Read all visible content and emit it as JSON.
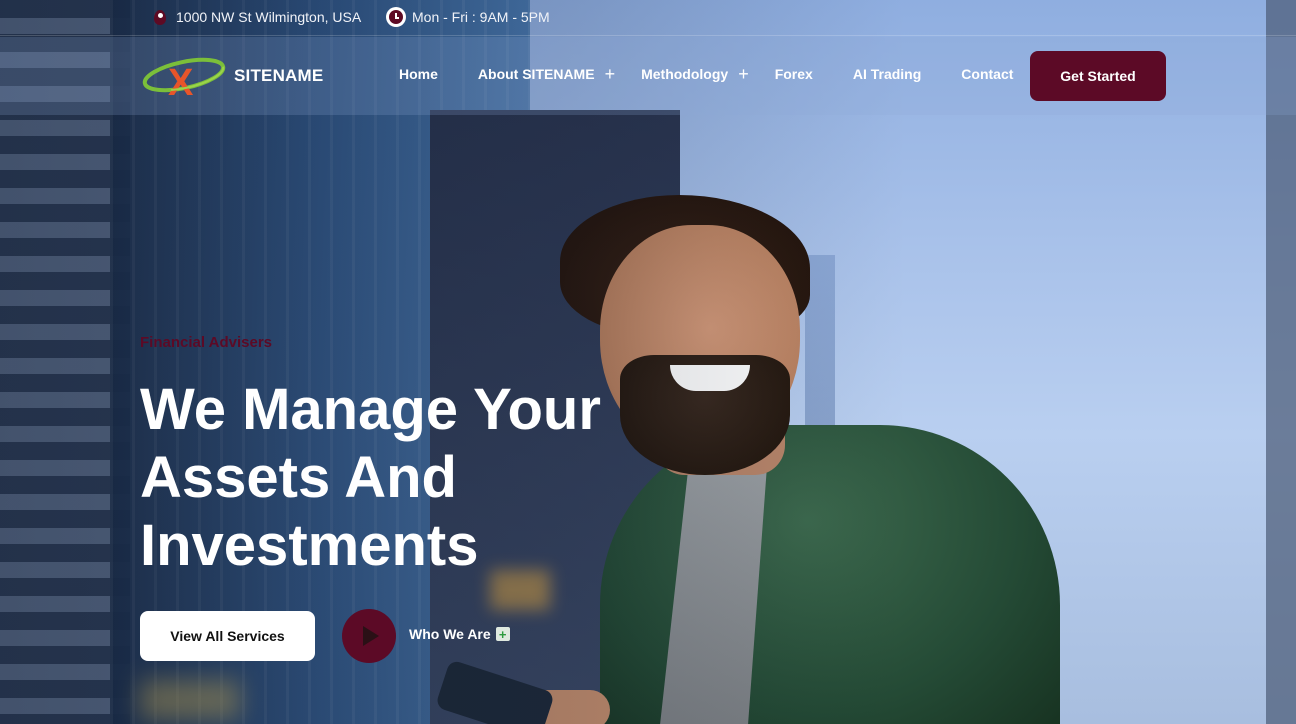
{
  "topbar": {
    "address": "1000 NW St Wilmington, USA",
    "address_icon": "location-pin-icon",
    "hours": "Mon - Fri : 9AM - 5PM",
    "hours_icon": "clock-icon"
  },
  "brand": {
    "name": "SITENAME",
    "logo_letter": "X",
    "colors": {
      "orange": "#e8552a",
      "green": "#7bbf3a",
      "maroon": "#5c0a26"
    }
  },
  "nav": {
    "items": [
      {
        "label": "Home"
      },
      {
        "label": "About SITENAME",
        "expand": "+"
      },
      {
        "label": "Methodology",
        "expand": "+"
      },
      {
        "label": "Forex"
      },
      {
        "label": "AI Trading"
      },
      {
        "label": "Contact"
      }
    ],
    "cta_label": "Get Started"
  },
  "hero": {
    "eyebrow": "Financial Advisers",
    "headline": "We Manage Your Assets And Investments",
    "primary_button": "View All Services",
    "play_icon": "play-icon",
    "secondary_link": "Who We Are",
    "secondary_icon": "plus-box-icon",
    "plus_symbol": "+"
  }
}
